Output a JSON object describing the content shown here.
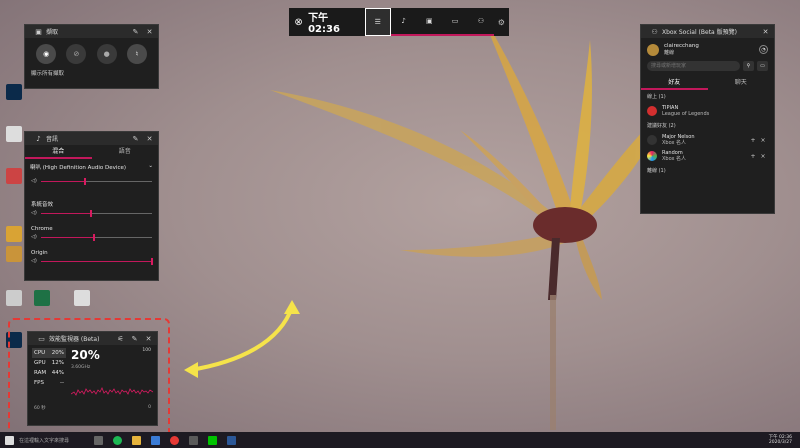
{
  "gamebar": {
    "logo_icon": "xbox-logo-icon",
    "time": "下午 02:36",
    "widgets": [
      "widget-menu-icon",
      "audio-icon",
      "capture-icon",
      "performance-icon",
      "social-icon"
    ],
    "settings_icon": "gear-icon"
  },
  "capture": {
    "title": "擷取",
    "buttons": [
      "screenshot-icon",
      "record-last-icon",
      "record-icon",
      "mic-off-icon"
    ],
    "link": "顯示所有擷取"
  },
  "audio": {
    "title": "音訊",
    "tabs": [
      "混合",
      "語音"
    ],
    "device": "喇叭 (High Definition Audio Device)",
    "master_level": 0.4,
    "rows": [
      {
        "label": "系統音效",
        "level": 0.45
      },
      {
        "label": "Chrome",
        "level": 0.48
      },
      {
        "label": "Origin",
        "level": 1.0
      }
    ]
  },
  "performance": {
    "title": "效能監視器 (Beta)",
    "stats": [
      {
        "name": "CPU",
        "value": "20%"
      },
      {
        "name": "GPU",
        "value": "12%"
      },
      {
        "name": "RAM",
        "value": "44%"
      },
      {
        "name": "FPS",
        "value": "--"
      }
    ],
    "big_value": "20%",
    "freq": "3.60GHz",
    "max": "100",
    "duration": "60 秒",
    "min": "0"
  },
  "social": {
    "title": "Xbox Social (Beta 版預覽)",
    "user": {
      "name": "clairecchang",
      "status": "離線"
    },
    "search_placeholder": "搜尋或新增玩家",
    "tabs": [
      "好友",
      "聊天"
    ],
    "online_header": "線上 (1)",
    "online": [
      {
        "name": "TIPIAN",
        "sub": "League of Legends"
      }
    ],
    "suggest_header": "建議好友 (2)",
    "suggested": [
      {
        "name": "Major Nelson",
        "sub": "Xbox 名人"
      },
      {
        "name": "Random",
        "sub": "Xbox 名人"
      }
    ],
    "offline_header": "離線 (1)"
  },
  "taskbar": {
    "search": "在這裡輸入文字來搜尋",
    "time": "下午 02:36",
    "date": "2020/3/27"
  },
  "colors": {
    "accent": "#c2185b",
    "panel": "#1f1f1f",
    "annotation": "#e53935",
    "arrow": "#f5e34a"
  }
}
